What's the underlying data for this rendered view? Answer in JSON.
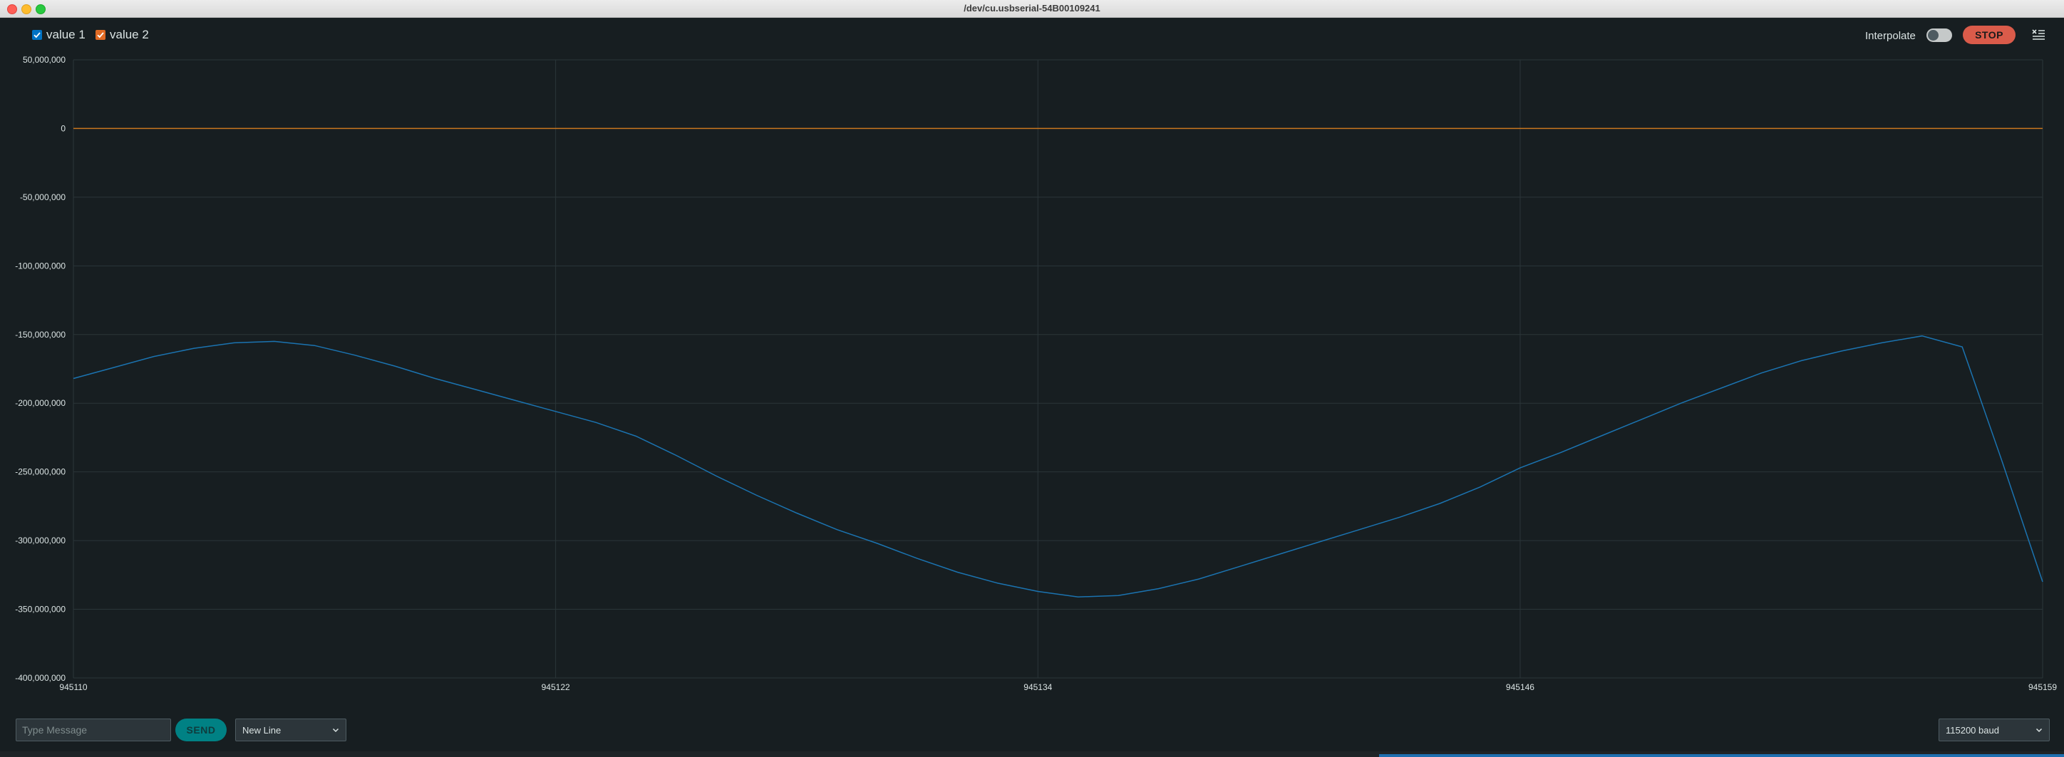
{
  "window": {
    "title": "/dev/cu.usbserial-54B00109241"
  },
  "legend": {
    "items": [
      {
        "label": "value 1",
        "color": "#0072c3",
        "checked": true
      },
      {
        "label": "value 2",
        "color": "#e06a24",
        "checked": true
      }
    ]
  },
  "controls": {
    "interpolate_label": "Interpolate",
    "interpolate_on": false,
    "stop_label": "STOP",
    "menu_icon": "clear-output-icon"
  },
  "bottom": {
    "message_placeholder": "Type Message",
    "send_label": "SEND",
    "line_ending": "New Line",
    "baud_rate": "115200 baud"
  },
  "colors": {
    "background": "#171e21",
    "grid": "#2b3639",
    "axis_text": "#dae3e3",
    "series1": "#1b73b0",
    "series2": "#c9771f",
    "stop": "#da5b4a",
    "send": "#008184"
  },
  "chart_data": {
    "type": "line",
    "title": "",
    "xlabel": "",
    "ylabel": "",
    "xlim": [
      945110,
      945159
    ],
    "ylim": [
      -400000000,
      50000000
    ],
    "xticks": [
      "945110",
      "945122",
      "945134",
      "945146",
      "945159"
    ],
    "xtick_values": [
      945110,
      945122,
      945134,
      945146,
      945159
    ],
    "yticks": [
      "50,000,000",
      "0",
      "-50,000,000",
      "-100,000,000",
      "-150,000,000",
      "-200,000,000",
      "-250,000,000",
      "-300,000,000",
      "-350,000,000",
      "-400,000,000"
    ],
    "ytick_values": [
      50000000,
      0,
      -50000000,
      -100000000,
      -150000000,
      -200000000,
      -250000000,
      -300000000,
      -350000000,
      -400000000
    ],
    "grid": true,
    "series": [
      {
        "name": "value 1",
        "x": [
          945110,
          945111,
          945112,
          945113,
          945114,
          945115,
          945116,
          945117,
          945118,
          945119,
          945120,
          945121,
          945122,
          945123,
          945124,
          945125,
          945126,
          945127,
          945128,
          945129,
          945130,
          945131,
          945132,
          945133,
          945134,
          945135,
          945136,
          945137,
          945138,
          945139,
          945140,
          945141,
          945142,
          945143,
          945144,
          945145,
          945146,
          945147,
          945148,
          945149,
          945150,
          945151,
          945152,
          945153,
          945154,
          945155,
          945156,
          945157,
          945158,
          945159
        ],
        "values": [
          -182000000,
          -174000000,
          -166000000,
          -160000000,
          -156000000,
          -155000000,
          -158000000,
          -165000000,
          -173000000,
          -182000000,
          -190000000,
          -198000000,
          -206000000,
          -214000000,
          -224000000,
          -238000000,
          -253000000,
          -267000000,
          -280000000,
          -292000000,
          -302000000,
          -313000000,
          -323000000,
          -331000000,
          -337000000,
          -341000000,
          -340000000,
          -335000000,
          -328000000,
          -319000000,
          -310000000,
          -301000000,
          -292000000,
          -283000000,
          -273000000,
          -261000000,
          -247000000,
          -236000000,
          -224000000,
          -212000000,
          -200000000,
          -189000000,
          -178000000,
          -169000000,
          -162000000,
          -156000000,
          -151000000,
          -159000000,
          -243000000,
          -330000000
        ]
      },
      {
        "name": "value 2",
        "x": [
          945110,
          945159
        ],
        "values": [
          0,
          0
        ]
      }
    ]
  }
}
